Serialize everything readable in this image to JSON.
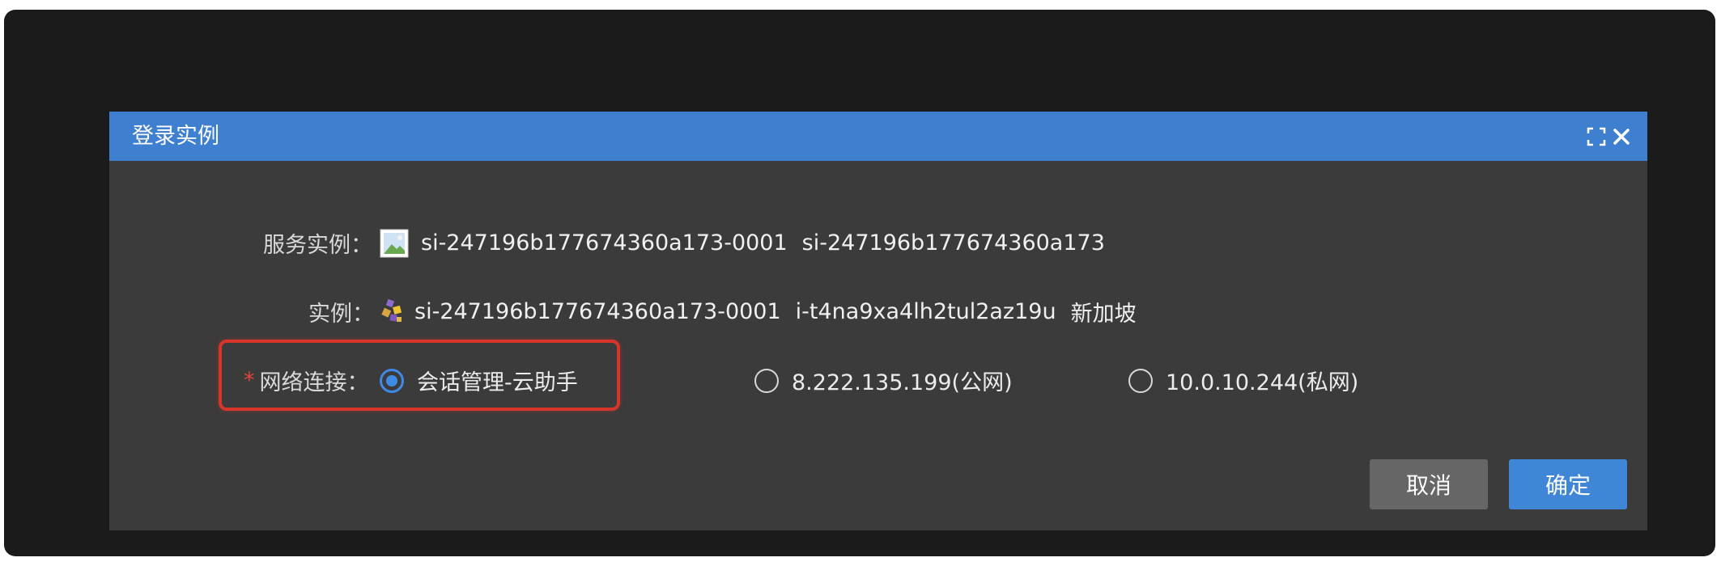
{
  "dialog": {
    "title": "登录实例",
    "header_color": "#3f7fcf",
    "icons": {
      "fullscreen": "fullscreen-icon",
      "close": "close-icon"
    }
  },
  "form": {
    "service_instance": {
      "label": "服务实例：",
      "icon": "image-icon",
      "id": "si-247196b177674360a173-0001",
      "name": "si-247196b177674360a173"
    },
    "instance": {
      "label": "实例：",
      "icon": "instance-icon",
      "id": "si-247196b177674360a173-0001",
      "instance_id": "i-t4na9xa4lh2tul2az19u",
      "region": "新加坡"
    },
    "network": {
      "required_mark": "*",
      "label": "网络连接：",
      "options": [
        {
          "label": "会话管理-云助手",
          "selected": true
        },
        {
          "label": "8.222.135.199(公网)",
          "selected": false
        },
        {
          "label": "10.0.10.244(私网)",
          "selected": false
        }
      ]
    }
  },
  "buttons": {
    "cancel": "取消",
    "confirm": "确定"
  }
}
